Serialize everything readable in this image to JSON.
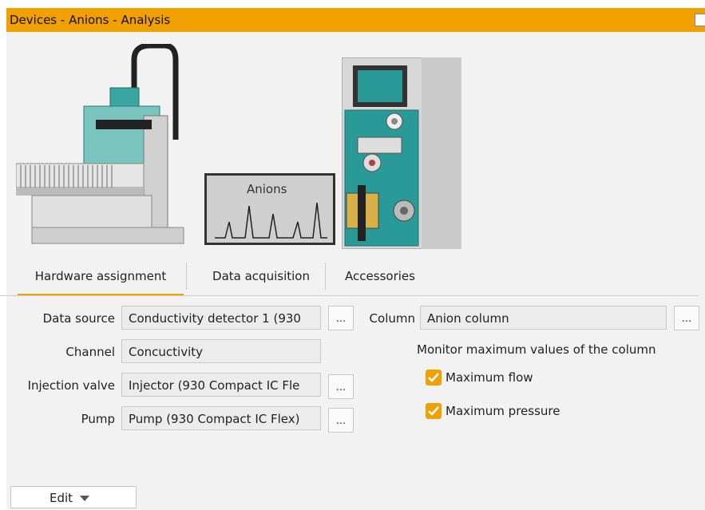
{
  "window": {
    "title": "Devices - Anions - Analysis"
  },
  "graphic": {
    "monitor_label": "Anions"
  },
  "tabs": [
    {
      "label": "Hardware assignment",
      "active": true
    },
    {
      "label": "Data acquisition",
      "active": false
    },
    {
      "label": "Accessories",
      "active": false
    }
  ],
  "form": {
    "data_source": {
      "label": "Data source",
      "value": "Conductivity detector 1 (930"
    },
    "channel": {
      "label": "Channel",
      "value": "Concuctivity"
    },
    "injection_valve": {
      "label": "Injection valve",
      "value": "Injector (930 Compact IC Fle"
    },
    "pump": {
      "label": "Pump",
      "value": "Pump (930 Compact IC Flex)"
    },
    "column": {
      "label": "Column",
      "value": "Anion column"
    },
    "browse_label": "...",
    "monitor_heading": "Monitor maximum values of the column",
    "max_flow": {
      "label": "Maximum flow",
      "checked": true
    },
    "max_pressure": {
      "label": "Maximum pressure",
      "checked": true
    }
  },
  "footer": {
    "edit_label": "Edit"
  },
  "colors": {
    "accent": "#f0a000",
    "instrument_teal": "#2a9a98"
  }
}
